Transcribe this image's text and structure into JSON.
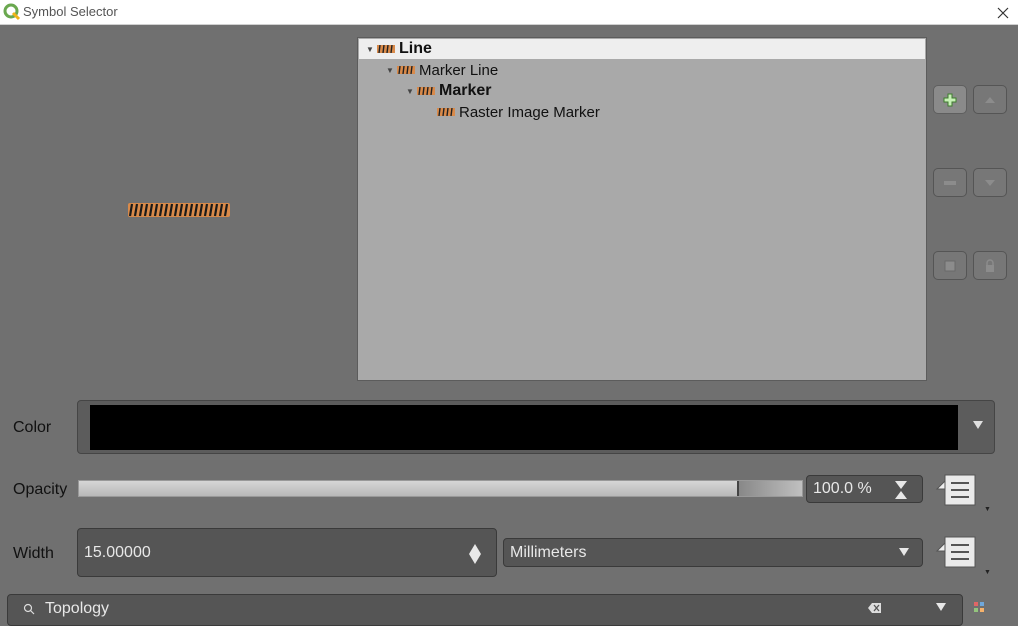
{
  "window": {
    "title": "Symbol Selector"
  },
  "tree": {
    "items": [
      {
        "label": "Line",
        "bold": true,
        "selected": true
      },
      {
        "label": "Marker Line",
        "bold": false,
        "selected": false
      },
      {
        "label": "Marker",
        "bold": true,
        "selected": false
      },
      {
        "label": "Raster Image Marker",
        "bold": false,
        "selected": false
      }
    ]
  },
  "side_buttons": {
    "add": "add-layer-icon",
    "move_up": "move-up-icon",
    "remove": "remove-layer-icon",
    "move_down": "move-down-icon",
    "duplicate": "duplicate-layer-icon",
    "lock": "lock-icon"
  },
  "form": {
    "color_label": "Color",
    "color_value": "#000000",
    "opacity_label": "Opacity",
    "opacity_value": "100.0 %",
    "opacity_fraction": 1.0,
    "width_label": "Width",
    "width_value": "15.00000",
    "unit_value": "Millimeters"
  },
  "search": {
    "value": "Topology"
  },
  "colors": {
    "dialog_bg": "#707070",
    "tree_bg": "#a9a9a9",
    "selected_row": "#eeeeee",
    "field_bg": "#555555",
    "symbol_orange": "#d98a4a"
  }
}
